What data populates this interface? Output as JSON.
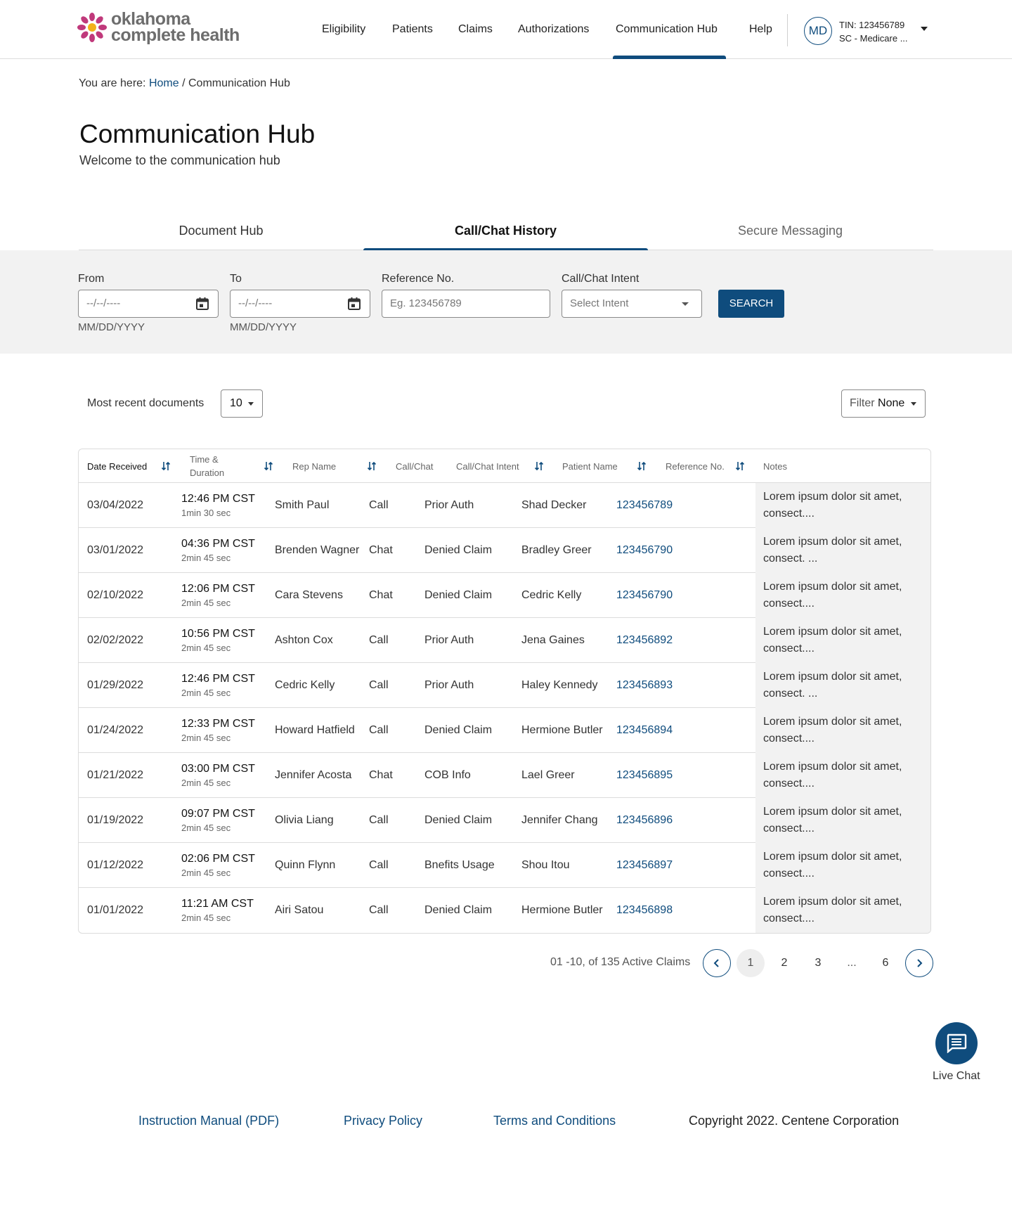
{
  "brand": {
    "line1": "oklahoma",
    "line2": "complete health",
    "accent": "#0f4c7d",
    "logo_colors": [
      "#c0397b",
      "#f2b21b"
    ]
  },
  "nav": {
    "items": [
      {
        "label": "Eligibility"
      },
      {
        "label": "Patients"
      },
      {
        "label": "Claims"
      },
      {
        "label": "Authorizations"
      },
      {
        "label": "Communication Hub",
        "active": true
      },
      {
        "label": "Help"
      }
    ],
    "user_initials": "MD",
    "tin": "TIN: 123456789",
    "plan": "SC - Medicare ..."
  },
  "breadcrumb": {
    "prefix": "You are here:",
    "home": "Home",
    "separator": "/",
    "current": "Communication Hub"
  },
  "page": {
    "title": "Communication Hub",
    "subtitle": "Welcome to the communication hub"
  },
  "tabs": [
    {
      "label": "Document Hub"
    },
    {
      "label": "Call/Chat History",
      "active": true
    },
    {
      "label": "Secure Messaging"
    }
  ],
  "filters": {
    "from_label": "From",
    "from_value": "--/--/----",
    "from_helper": "MM/DD/YYYY",
    "to_label": "To",
    "to_value": "--/--/----",
    "to_helper": "MM/DD/YYYY",
    "reference_label": "Reference No.",
    "reference_placeholder": "Eg. 123456789",
    "intent_label": "Call/Chat Intent",
    "intent_placeholder": "Select Intent",
    "search_label": "SEARCH"
  },
  "controls": {
    "recent_label": "Most recent documents",
    "recent_value": "10",
    "filter_label": "Filter",
    "filter_value": "None"
  },
  "table": {
    "headers": {
      "date": "Date Received",
      "time_line1": "Time &",
      "time_line2": "Duration",
      "rep": "Rep Name",
      "type": "Call/Chat",
      "intent": "Call/Chat Intent",
      "patient": "Patient Name",
      "ref": "Reference No.",
      "notes": "Notes"
    },
    "rows": [
      {
        "date": "03/04/2022",
        "time": "12:46 PM CST",
        "duration": "1min 30 sec",
        "rep": "Smith Paul",
        "type": "Call",
        "intent": "Prior Auth",
        "patient": "Shad Decker",
        "ref": "123456789",
        "notes": "Lorem ipsum dolor sit amet, consect...."
      },
      {
        "date": "03/01/2022",
        "time": "04:36 PM CST",
        "duration": "2min 45 sec",
        "rep": "Brenden Wagner",
        "type": "Chat",
        "intent": "Denied Claim",
        "patient": "Bradley Greer",
        "ref": "123456790",
        "notes": "Lorem ipsum dolor sit amet, consect. ..."
      },
      {
        "date": "02/10/2022",
        "time": "12:06 PM CST",
        "duration": "2min 45 sec",
        "rep": "Cara Stevens",
        "type": "Chat",
        "intent": "Denied Claim",
        "patient": "Cedric Kelly",
        "ref": "123456790",
        "notes": "Lorem ipsum dolor sit amet, consect...."
      },
      {
        "date": "02/02/2022",
        "time": "10:56 PM CST",
        "duration": "2min 45 sec",
        "rep": "Ashton Cox",
        "type": "Call",
        "intent": "Prior Auth",
        "patient": "Jena Gaines",
        "ref": "123456892",
        "notes": "Lorem ipsum dolor sit amet, consect...."
      },
      {
        "date": "01/29/2022",
        "time": "12:46 PM CST",
        "duration": "2min 45 sec",
        "rep": "Cedric Kelly",
        "type": "Call",
        "intent": "Prior Auth",
        "patient": "Haley Kennedy",
        "ref": "123456893",
        "notes": "Lorem ipsum dolor sit amet, consect. ..."
      },
      {
        "date": "01/24/2022",
        "time": "12:33 PM CST",
        "duration": "2min 45 sec",
        "rep": "Howard Hatfield",
        "type": "Call",
        "intent": "Denied Claim",
        "patient": "Hermione Butler",
        "ref": "123456894",
        "notes": "Lorem ipsum dolor sit amet, consect...."
      },
      {
        "date": "01/21/2022",
        "time": "03:00 PM CST",
        "duration": "2min 45 sec",
        "rep": "Jennifer Acosta",
        "type": "Chat",
        "intent": "COB Info",
        "patient": "Lael Greer",
        "ref": "123456895",
        "notes": "Lorem ipsum dolor sit amet, consect...."
      },
      {
        "date": "01/19/2022",
        "time": "09:07 PM CST",
        "duration": "2min 45 sec",
        "rep": "Olivia Liang",
        "type": "Call",
        "intent": "Denied Claim",
        "patient": "Jennifer Chang",
        "ref": "123456896",
        "notes": "Lorem ipsum dolor sit amet, consect...."
      },
      {
        "date": "01/12/2022",
        "time": "02:06 PM CST",
        "duration": "2min 45 sec",
        "rep": "Quinn Flynn",
        "type": "Call",
        "intent": "Bnefits Usage",
        "patient": "Shou Itou",
        "ref": "123456897",
        "notes": "Lorem ipsum dolor sit amet, consect...."
      },
      {
        "date": "01/01/2022",
        "time": "11:21 AM CST",
        "duration": "2min 45 sec",
        "rep": "Airi Satou",
        "type": "Call",
        "intent": "Denied Claim",
        "patient": "Hermione Butler",
        "ref": "123456898",
        "notes": "Lorem ipsum dolor sit amet, consect...."
      }
    ]
  },
  "pagination": {
    "summary": "01 -10, of 135 Active Claims",
    "pages": [
      "1",
      "2",
      "3",
      "...",
      "6"
    ],
    "current": "1"
  },
  "live_chat": {
    "label": "Live Chat"
  },
  "footer": {
    "links": [
      "Instruction Manual (PDF)",
      "Privacy Policy",
      "Terms and Conditions"
    ],
    "copyright": "Copyright 2022. Centene Corporation"
  }
}
